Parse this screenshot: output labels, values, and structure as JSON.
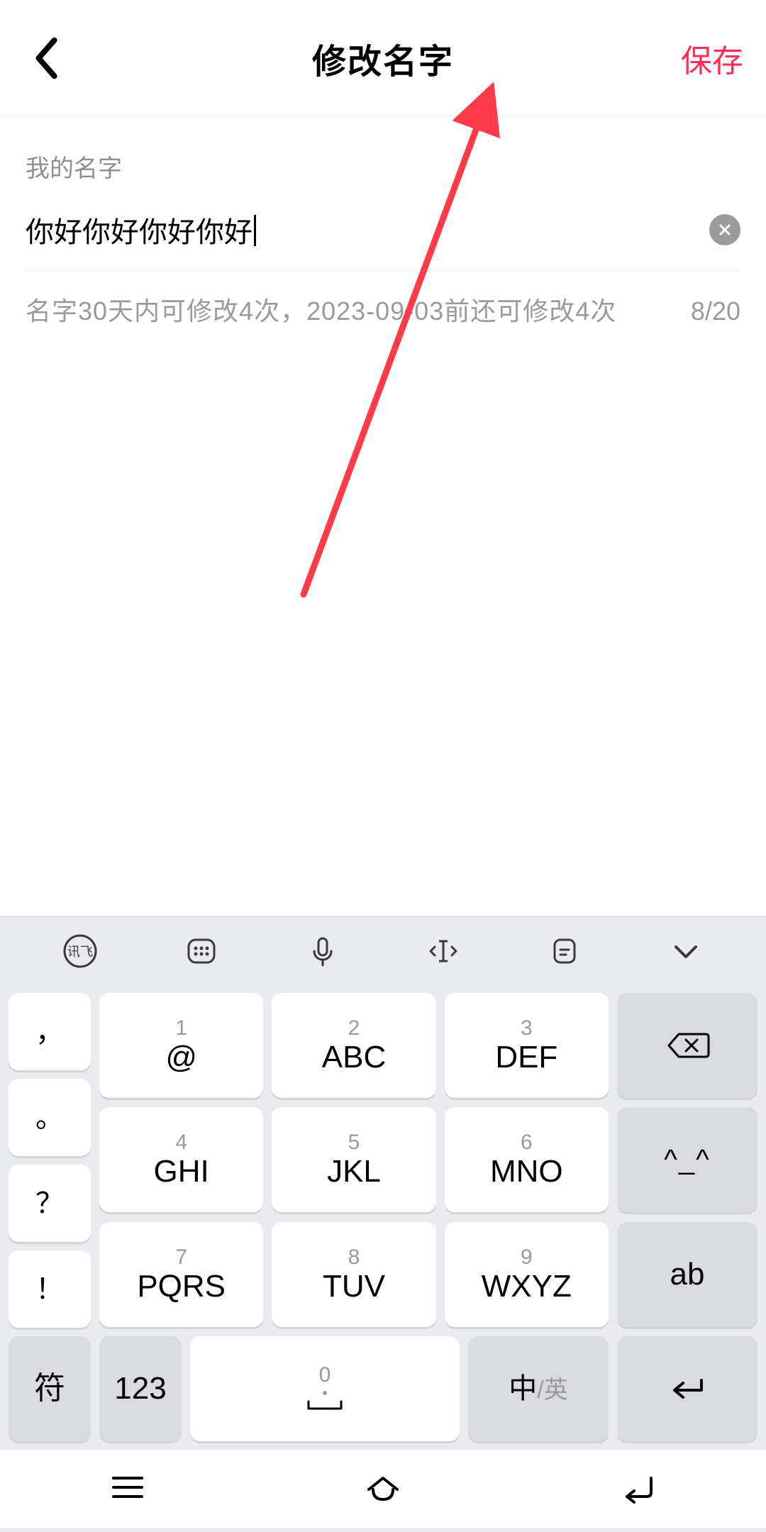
{
  "header": {
    "title": "修改名字",
    "save_label": "保存"
  },
  "form": {
    "field_label": "我的名字",
    "name_value": "你好你好你好你好",
    "hint_text": "名字30天内可修改4次，2023-09-03前还可修改4次",
    "counter": "8/20"
  },
  "annotation": {
    "color": "#ff3b4a"
  },
  "keyboard": {
    "toolbar_icons": [
      "ime-logo-icon",
      "keypad-icon",
      "mic-icon",
      "cursor-move-icon",
      "clipboard-icon",
      "collapse-icon"
    ],
    "punct_col": [
      "，",
      "。",
      "？",
      "！"
    ],
    "main_rows": [
      [
        {
          "d": "1",
          "l": "@"
        },
        {
          "d": "2",
          "l": "ABC"
        },
        {
          "d": "3",
          "l": "DEF"
        }
      ],
      [
        {
          "d": "4",
          "l": "GHI"
        },
        {
          "d": "5",
          "l": "JKL"
        },
        {
          "d": "6",
          "l": "MNO"
        }
      ],
      [
        {
          "d": "7",
          "l": "PQRS"
        },
        {
          "d": "8",
          "l": "TUV"
        },
        {
          "d": "9",
          "l": "WXYZ"
        }
      ]
    ],
    "right_col": [
      "backspace",
      "^_^",
      "ab"
    ],
    "row4": {
      "symbol_label": "符",
      "numeric_label": "123",
      "space_digit": "0",
      "lang_primary": "中",
      "lang_secondary": "/英"
    }
  }
}
